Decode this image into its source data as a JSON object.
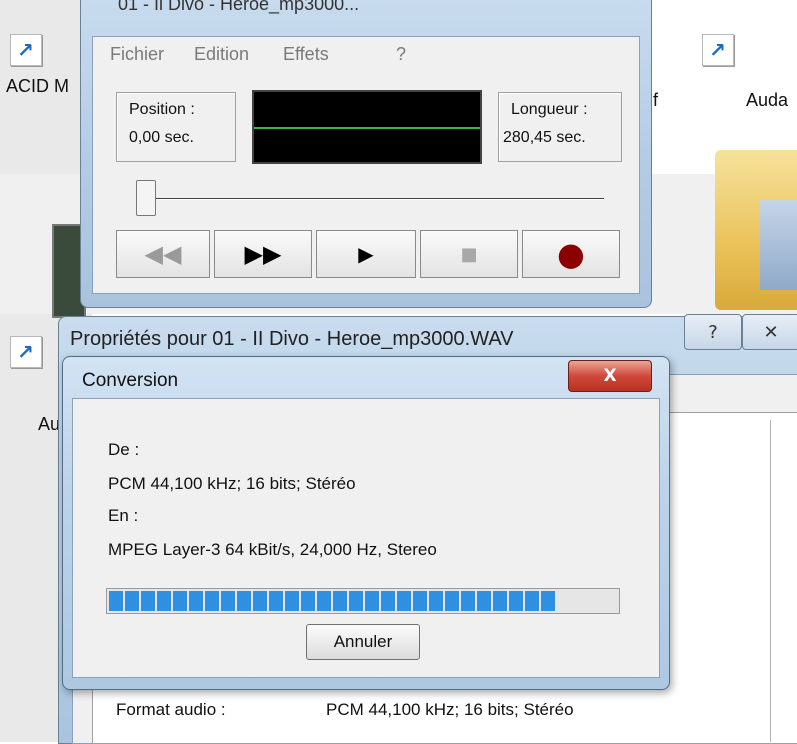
{
  "desktop": {
    "icon_labels": {
      "left": "ACID M",
      "right": "Auda",
      "partial_right": "f",
      "partial_left_low": "Au"
    }
  },
  "sound_recorder": {
    "title": "01 - Il Divo - Heroe_mp3000...",
    "menu": [
      "Fichier",
      "Edition",
      "Effets",
      "?"
    ],
    "position_label": "Position :",
    "position_value": "0,00 sec.",
    "length_label": "Longueur :",
    "length_value": "280,45 sec.",
    "buttons": {
      "rewind": "◀◀",
      "forward": "▶▶",
      "play": "▶",
      "stop": "■",
      "record": "●"
    },
    "colors": {
      "waveform": "#37b34a",
      "record": "#8b0000"
    }
  },
  "properties": {
    "title": "Propriétés pour 01 - II Divo - Heroe_mp3000.WAV",
    "help_button": "?",
    "close_button": "✕",
    "format_label": "Format audio :",
    "format_value": "PCM 44,100 kHz; 16 bits; Stéréo"
  },
  "conversion": {
    "title": "Conversion",
    "close_button": "X",
    "from_label": "De :",
    "from_value": "PCM 44,100 kHz; 16 bits; Stéréo",
    "to_label": "En :",
    "to_value": "MPEG Layer-3 64 kBit/s, 24,000 Hz, Stereo",
    "progress_fraction": 0.88,
    "cancel_label": "Annuler",
    "colors": {
      "progress": "#2f8fe0",
      "close_button": "#d0493a"
    }
  }
}
